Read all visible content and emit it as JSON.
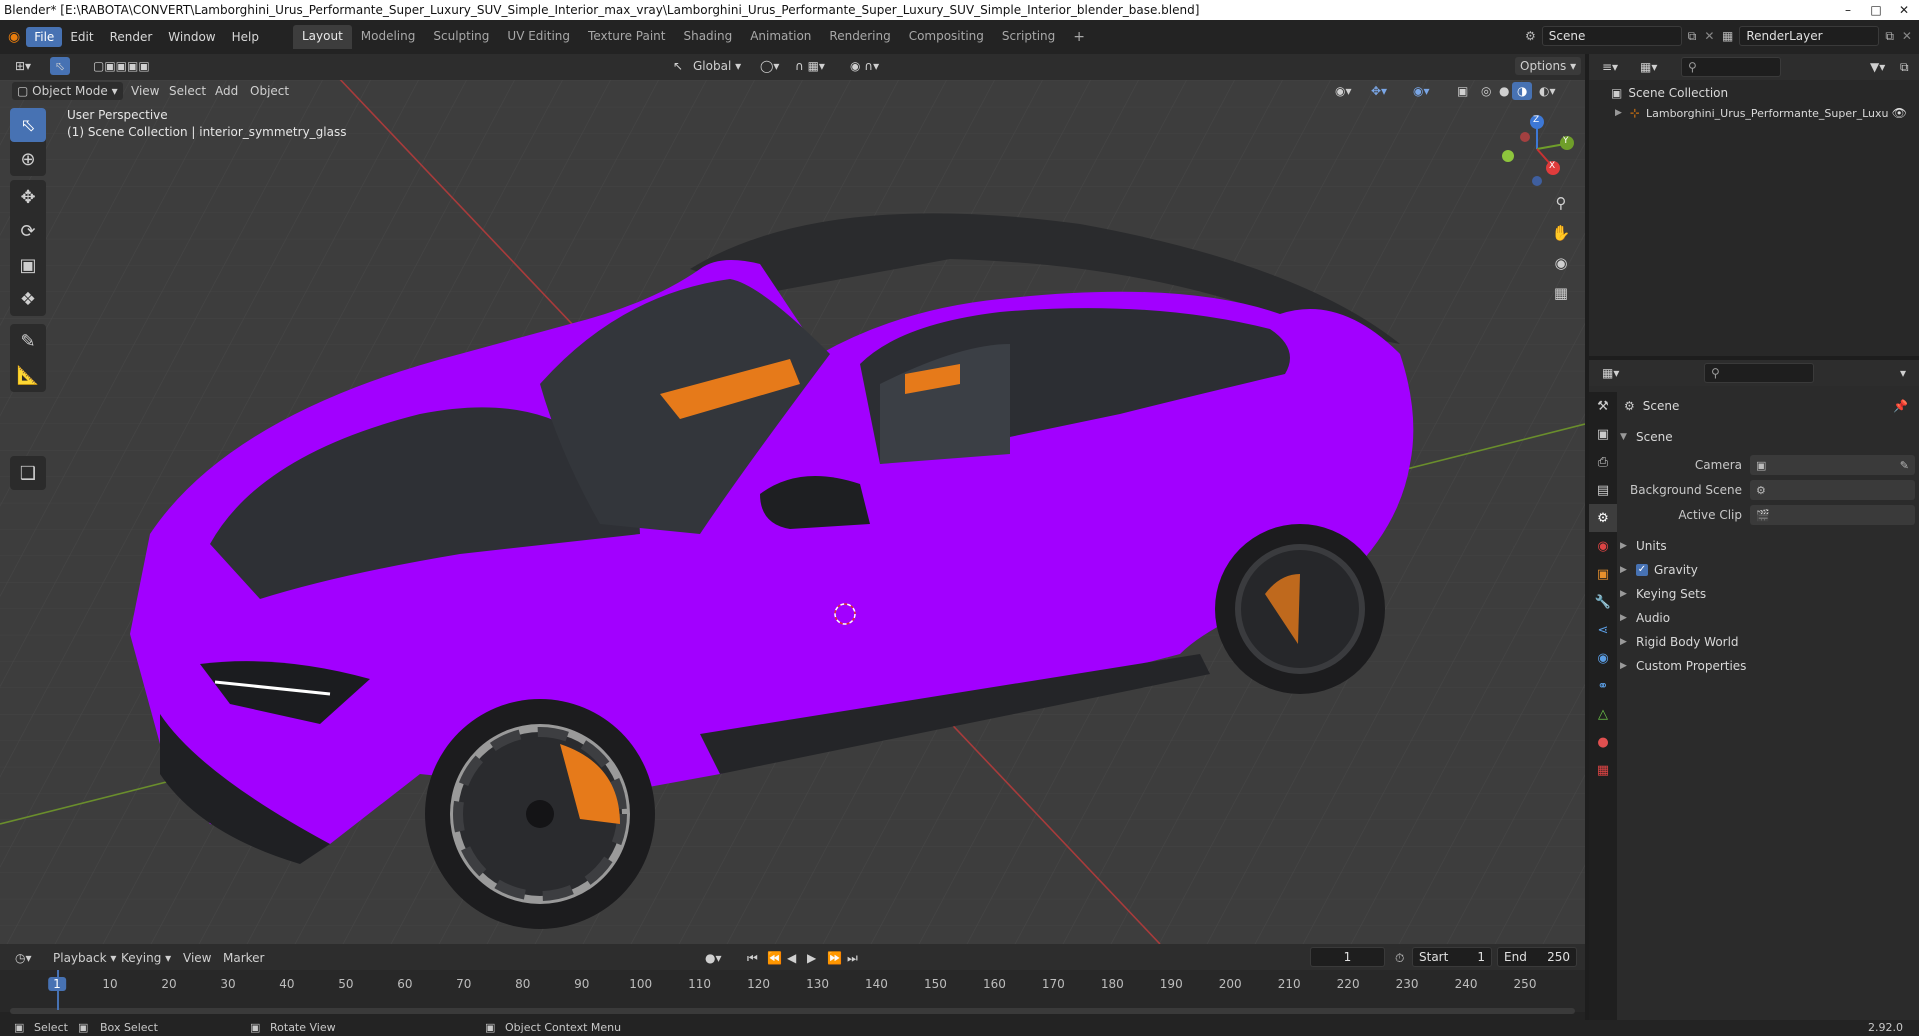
{
  "window": {
    "title": "Blender* [E:\\RABOTA\\CONVERT\\Lamborghini_Urus_Performante_Super_Luxury_SUV_Simple_Interior_max_vray\\Lamborghini_Urus_Performante_Super_Luxury_SUV_Simple_Interior_blender_base.blend]"
  },
  "menubar": {
    "items": [
      "File",
      "Edit",
      "Render",
      "Window",
      "Help"
    ]
  },
  "workspaces": [
    "Layout",
    "Modeling",
    "Sculpting",
    "UV Editing",
    "Texture Paint",
    "Shading",
    "Animation",
    "Rendering",
    "Compositing",
    "Scripting"
  ],
  "add_tab": "+",
  "scene_field": "Scene",
  "renderlayer_field": "RenderLayer",
  "viewport": {
    "mode": "Object Mode",
    "menus": [
      "View",
      "Select",
      "Add",
      "Object"
    ],
    "transform_orientation": "Global",
    "options_label": "Options",
    "overlay_title": "User Perspective",
    "overlay_subtitle": "(1) Scene Collection | interior_symmetry_glass",
    "gizmo_axes": [
      "Z",
      "Y",
      "X"
    ]
  },
  "outliner": {
    "root": "Scene Collection",
    "child": "Lamborghini_Urus_Performante_Super_Luxu"
  },
  "properties": {
    "header": "Scene",
    "section": "Scene",
    "fields": [
      {
        "label": "Camera",
        "value": ""
      },
      {
        "label": "Background Scene",
        "value": ""
      },
      {
        "label": "Active Clip",
        "value": ""
      }
    ],
    "panels": [
      "Units",
      "Gravity",
      "Keying Sets",
      "Audio",
      "Rigid Body World",
      "Custom Properties"
    ],
    "gravity_checked": true
  },
  "timeline": {
    "menus": [
      "Playback",
      "Keying",
      "View",
      "Marker"
    ],
    "current_frame": "1",
    "start_label": "Start",
    "start_value": "1",
    "end_label": "End",
    "end_value": "250",
    "ticks": [
      "1",
      "10",
      "20",
      "30",
      "40",
      "50",
      "60",
      "70",
      "80",
      "90",
      "100",
      "110",
      "120",
      "130",
      "140",
      "150",
      "160",
      "170",
      "180",
      "190",
      "200",
      "210",
      "220",
      "230",
      "240",
      "250"
    ]
  },
  "statusbar": {
    "select": "Select",
    "box_select": "Box Select",
    "rotate": "Rotate View",
    "context_menu": "Object Context Menu",
    "version": "2.92.0"
  },
  "colors": {
    "body_paint": "#a200ff",
    "accent": "#4772b3",
    "viewport_bg": "#3d3d3d"
  }
}
